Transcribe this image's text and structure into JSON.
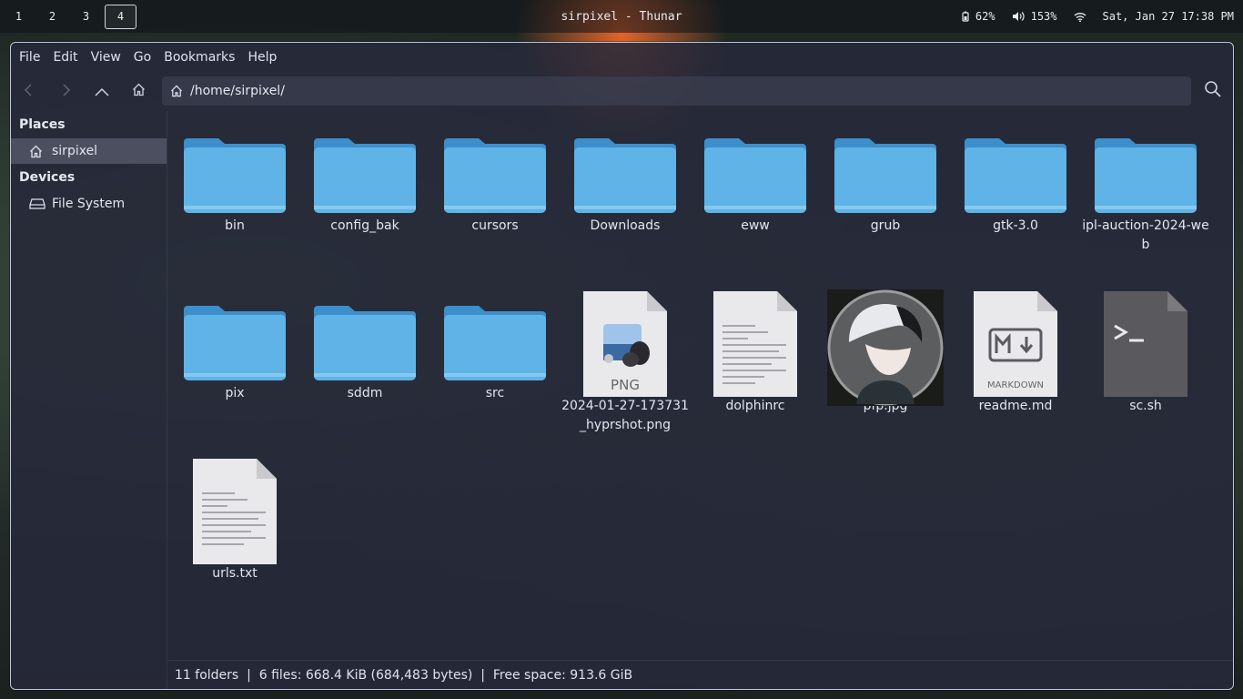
{
  "topbar": {
    "workspaces": [
      "1",
      "2",
      "3",
      "4"
    ],
    "active_workspace": "4",
    "title": "sirpixel - Thunar",
    "battery": "62%",
    "volume": "153%",
    "datetime": "Sat, Jan 27 17:38 PM"
  },
  "menubar": {
    "items": [
      "File",
      "Edit",
      "View",
      "Go",
      "Bookmarks",
      "Help"
    ]
  },
  "toolbar": {
    "path": "/home/sirpixel/"
  },
  "sidebar": {
    "places_heading": "Places",
    "places": [
      {
        "label": "sirpixel",
        "icon": "home-icon"
      }
    ],
    "devices_heading": "Devices",
    "devices": [
      {
        "label": "File System",
        "icon": "drive-icon"
      }
    ]
  },
  "files": [
    {
      "name": "bin",
      "type": "folder"
    },
    {
      "name": "config_bak",
      "type": "folder"
    },
    {
      "name": "cursors",
      "type": "folder"
    },
    {
      "name": "Downloads",
      "type": "folder"
    },
    {
      "name": "eww",
      "type": "folder"
    },
    {
      "name": "grub",
      "type": "folder"
    },
    {
      "name": "gtk-3.0",
      "type": "folder"
    },
    {
      "name": "ipl-auction-2024-web",
      "type": "folder"
    },
    {
      "name": "pix",
      "type": "folder"
    },
    {
      "name": "sddm",
      "type": "folder"
    },
    {
      "name": "src",
      "type": "folder"
    },
    {
      "name": "2024-01-27-173731_hyprshot.png",
      "type": "png",
      "badge": "PNG"
    },
    {
      "name": "dolphinrc",
      "type": "text"
    },
    {
      "name": "pfp.jpg",
      "type": "image"
    },
    {
      "name": "readme.md",
      "type": "markdown",
      "badge": "MARKDOWN"
    },
    {
      "name": "sc.sh",
      "type": "script"
    },
    {
      "name": "urls.txt",
      "type": "text"
    }
  ],
  "statusbar": {
    "text": "11 folders  |  6 files: 668.4 KiB (684,483 bytes)  |  Free space: 913.6 GiB"
  },
  "colors": {
    "folder": "#5fb3e6",
    "window_bg": "#26293a",
    "accent_border": "#bfc8df"
  }
}
